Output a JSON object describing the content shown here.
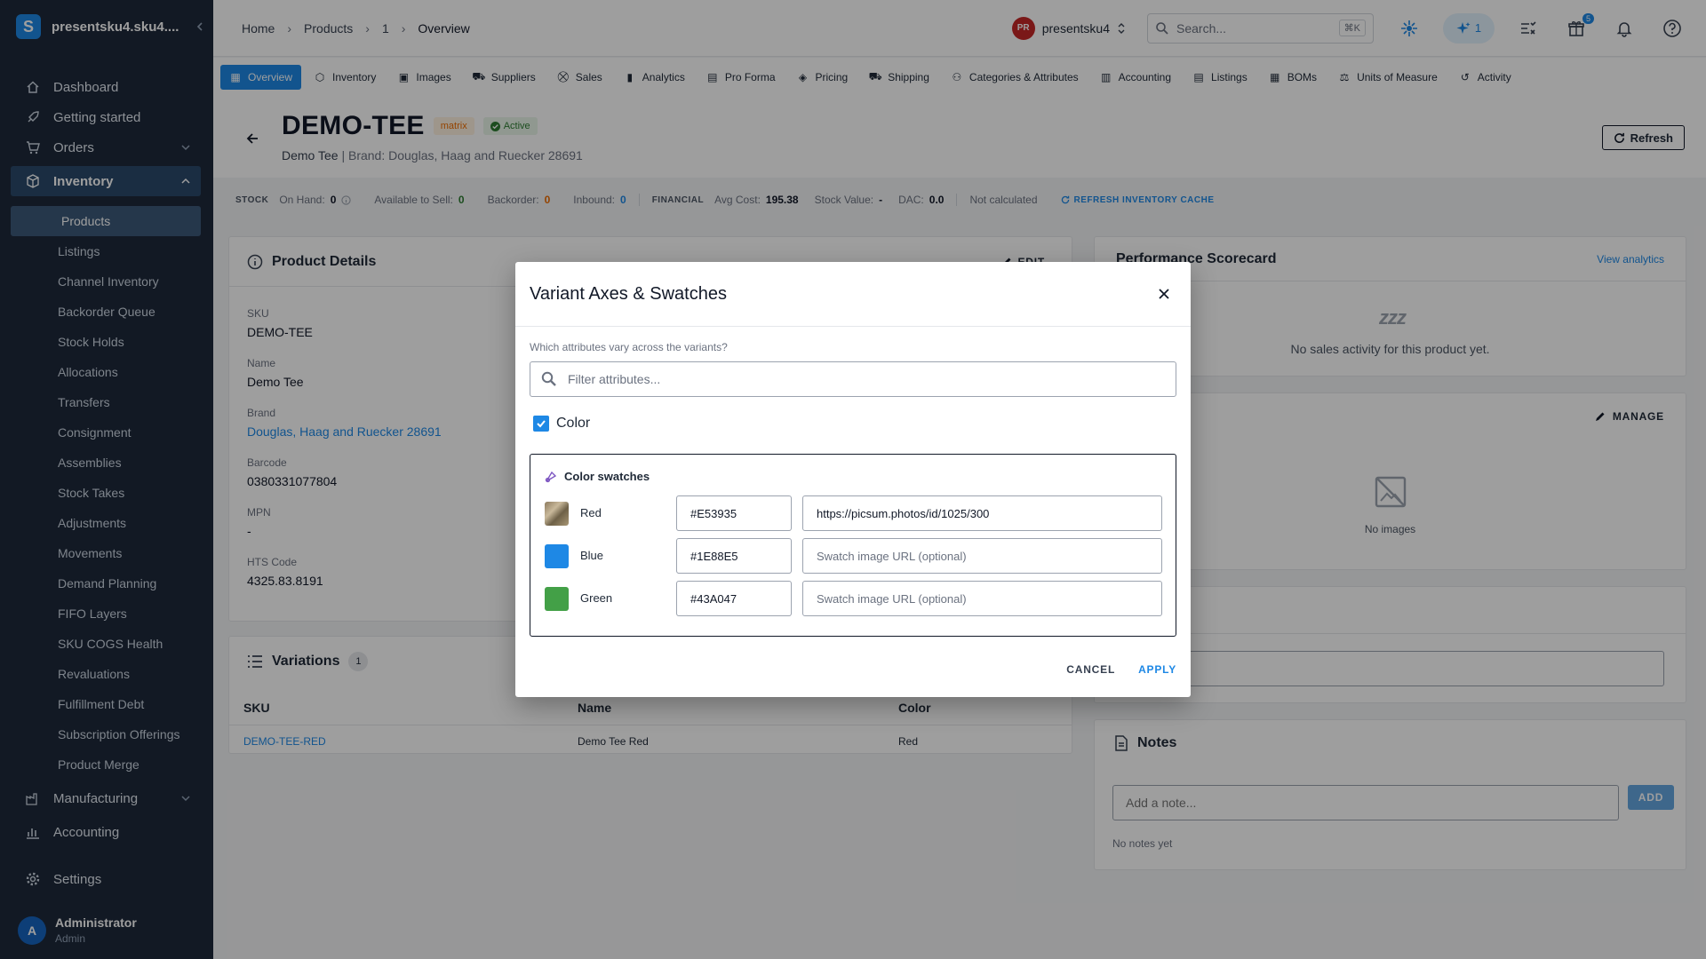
{
  "sidebar": {
    "workspace": "presentsku4.sku4....",
    "nav": {
      "dashboard": "Dashboard",
      "getting_started": "Getting started",
      "orders": "Orders",
      "inventory": "Inventory",
      "manufacturing": "Manufacturing",
      "accounting": "Accounting",
      "settings": "Settings"
    },
    "inventory_items": [
      "Products",
      "Listings",
      "Channel Inventory",
      "Backorder Queue",
      "Stock Holds",
      "Allocations",
      "Transfers",
      "Consignment",
      "Assemblies",
      "Stock Takes",
      "Adjustments",
      "Movements",
      "Demand Planning",
      "FIFO Layers",
      "SKU COGS Health",
      "Revaluations",
      "Fulfillment Debt",
      "Subscription Offerings",
      "Product Merge"
    ],
    "user": {
      "initial": "A",
      "name": "Administrator",
      "role": "Admin"
    }
  },
  "topbar": {
    "breadcrumbs": [
      "Home",
      "Products",
      "1",
      "Overview"
    ],
    "account_initials": "PR",
    "account_name": "presentsku4",
    "search_placeholder": "Search...",
    "search_shortcut": "⌘K",
    "ai_count": "1",
    "gift_badge": "5"
  },
  "tabs": [
    "Overview",
    "Inventory",
    "Images",
    "Suppliers",
    "Sales",
    "Analytics",
    "Pro Forma",
    "Pricing",
    "Shipping",
    "Categories & Attributes",
    "Accounting",
    "Listings",
    "BOMs",
    "Units of Measure",
    "Activity"
  ],
  "product": {
    "sku": "DEMO-TEE",
    "type_chip": "matrix",
    "status": "Active",
    "name": "Demo Tee",
    "subtitle_sep": " | ",
    "brand_line": "Brand: Douglas, Haag and Ruecker 28691",
    "refresh_label": "Refresh"
  },
  "stats": {
    "stock_label": "STOCK",
    "on_hand_label": "On Hand:",
    "on_hand": "0",
    "available_label": "Available to Sell:",
    "available": "0",
    "backorder_label": "Backorder:",
    "backorder": "0",
    "inbound_label": "Inbound:",
    "inbound": "0",
    "financial_label": "FINANCIAL",
    "avg_cost_label": "Avg Cost:",
    "avg_cost": "195.38",
    "stock_value_label": "Stock Value:",
    "stock_value": "-",
    "dac_label": "DAC:",
    "dac": "0.0",
    "not_calculated": "Not calculated",
    "refresh_cache": "REFRESH INVENTORY CACHE"
  },
  "details": {
    "title": "Product Details",
    "edit": "EDIT",
    "fields": [
      {
        "label": "SKU",
        "value": "DEMO-TEE"
      },
      {
        "label": "Name",
        "value": "Demo Tee"
      },
      {
        "label": "Brand",
        "value": "Douglas, Haag and Ruecker 28691"
      },
      {
        "label": "Barcode",
        "value": "0380331077804"
      },
      {
        "label": "MPN",
        "value": "-"
      },
      {
        "label": "HTS Code",
        "value": "4325.83.8191"
      }
    ]
  },
  "variations": {
    "title": "Variations",
    "count": "1",
    "columns": [
      "SKU",
      "Name",
      "Color"
    ],
    "rows": [
      {
        "sku": "DEMO-TEE-RED",
        "name": "Demo Tee Red",
        "color": "Red"
      }
    ]
  },
  "scorecard": {
    "title": "Performance Scorecard",
    "link": "View analytics",
    "sleep": "zzz",
    "empty": "No sales activity for this product yet."
  },
  "images_card": {
    "manage": "MANAGE",
    "empty": "No images"
  },
  "notes": {
    "title": "Notes",
    "placeholder": "Add a note...",
    "add": "ADD",
    "empty": "No notes yet"
  },
  "modal": {
    "title": "Variant Axes & Swatches",
    "caption": "Which attributes vary across the variants?",
    "filter_placeholder": "Filter attributes...",
    "attribute": "Color",
    "swatches_title": "Color swatches",
    "url_placeholder": "Swatch image URL (optional)",
    "swatches": [
      {
        "name": "Red",
        "hex": "#E53935",
        "url": "https://picsum.photos/id/1025/300",
        "color": "#E53935"
      },
      {
        "name": "Blue",
        "hex": "#1E88E5",
        "url": "",
        "color": "#1E88E5"
      },
      {
        "name": "Green",
        "hex": "#43A047",
        "url": "",
        "color": "#43A047"
      }
    ],
    "cancel": "CANCEL",
    "apply": "APPLY"
  },
  "colors": {
    "accent": "#1E88E5",
    "sidebar": "#1E293B"
  }
}
